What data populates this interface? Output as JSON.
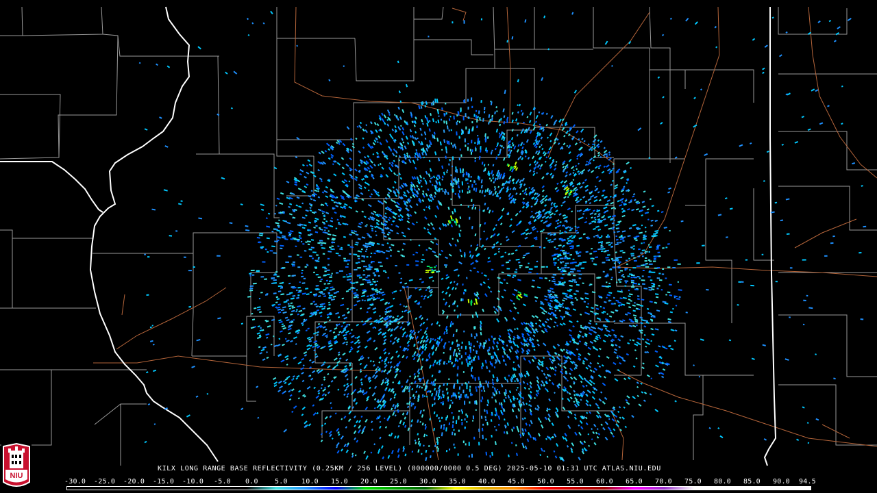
{
  "product": {
    "caption": "KILX LONG RANGE BASE REFLECTIVITY (0.25KM / 256 LEVEL) (000000/0000 0.5 DEG) 2025-05-10 01:31 UTC  ATLAS.NIU.EDU",
    "site": "KILX",
    "elevation_deg": 0.5,
    "valid_time": "2025-05-10 01:31 UTC",
    "source": "ATLAS.NIU.EDU"
  },
  "logo": {
    "text": "NIU",
    "colors": [
      "#c8102e",
      "#ffffff",
      "#000000"
    ]
  },
  "colorbar": {
    "labels": [
      "-30.0",
      "-25.0",
      "-20.0",
      "-15.0",
      "-10.0",
      "-5.0",
      "0.0",
      "5.0",
      "10.0",
      "15.0",
      "20.0",
      "25.0",
      "30.0",
      "35.0",
      "40.0",
      "45.0",
      "50.0",
      "55.0",
      "60.0",
      "65.0",
      "70.0",
      "75.0",
      "80.0",
      "85.0",
      "90.0",
      "94.5"
    ],
    "stops": [
      {
        "dbz": -30,
        "color": "#000000"
      },
      {
        "dbz": 0,
        "color": "#000000"
      },
      {
        "dbz": 5,
        "color": "#40e0e0"
      },
      {
        "dbz": 10,
        "color": "#1e90ff"
      },
      {
        "dbz": 15,
        "color": "#0000ff"
      },
      {
        "dbz": 20,
        "color": "#00e000"
      },
      {
        "dbz": 25,
        "color": "#00a000"
      },
      {
        "dbz": 30,
        "color": "#006400"
      },
      {
        "dbz": 35,
        "color": "#ffff00"
      },
      {
        "dbz": 40,
        "color": "#e0b000"
      },
      {
        "dbz": 45,
        "color": "#ff8c00"
      },
      {
        "dbz": 50,
        "color": "#ff0000"
      },
      {
        "dbz": 55,
        "color": "#c80000"
      },
      {
        "dbz": 60,
        "color": "#a00000"
      },
      {
        "dbz": 65,
        "color": "#ff00ff"
      },
      {
        "dbz": 70,
        "color": "#9932cc"
      },
      {
        "dbz": 75,
        "color": "#ffffff"
      },
      {
        "dbz": 94.5,
        "color": "#ffffff"
      }
    ]
  },
  "map": {
    "background": "#000000",
    "state_border_color": "#ffffff",
    "county_border_color": "#9a9a9a",
    "highway_color": "#b5653a",
    "echo_colors": [
      "#00c8ff",
      "#1e90ff",
      "#0060ff",
      "#40e0e0",
      "#2a9df4",
      "#00e060",
      "#c8ff00"
    ]
  }
}
